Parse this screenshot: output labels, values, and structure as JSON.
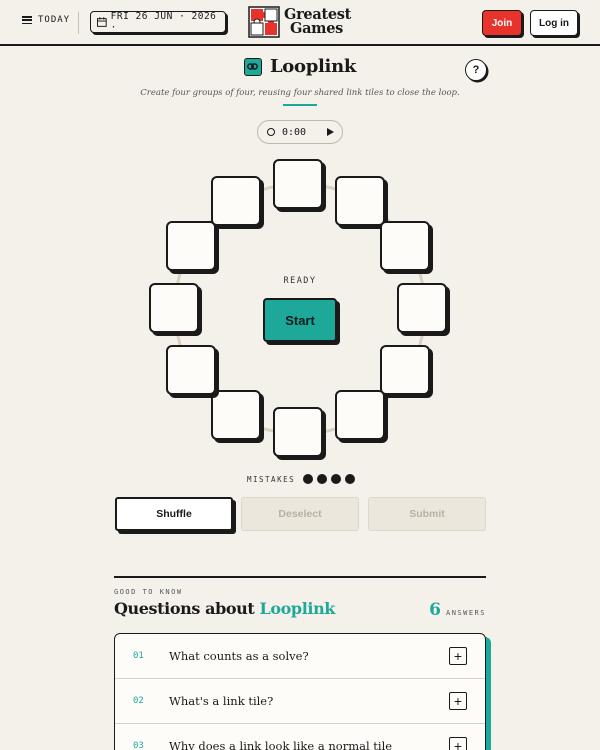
{
  "header": {
    "today_label": "TODAY",
    "date_label": "FRI 26 JUN · 2026 ·",
    "logo_line1": "Greatest",
    "logo_line2": "Games",
    "join_label": "Join",
    "login_label": "Log in"
  },
  "game": {
    "title": "Looplink",
    "subtitle": "Create four groups of four, reusing four shared link tiles to close the loop.",
    "help_label": "?",
    "timer": "0:00",
    "status": "READY",
    "start_label": "Start",
    "mistakes_label": "MISTAKES",
    "mistakes_remaining": 4,
    "tile_count": 12
  },
  "actions": {
    "shuffle": "Shuffle",
    "deselect": "Deselect",
    "submit": "Submit"
  },
  "faq": {
    "eyebrow": "GOOD TO KNOW",
    "title_prefix": "Questions about ",
    "title_accent": "Looplink",
    "count": "6",
    "count_label": "ANSWERS",
    "items": [
      {
        "num": "01",
        "question": "What counts as a solve?"
      },
      {
        "num": "02",
        "question": "What's a link tile?"
      },
      {
        "num": "03",
        "question": "Why does a link look like a normal tile"
      }
    ]
  },
  "colors": {
    "background": "#f4f1ea",
    "accent": "#1ea89a",
    "join": "#e8322c",
    "ink": "#1a1a1a"
  },
  "icons": [
    "hamburger-icon",
    "calendar-icon",
    "link-icon",
    "clock-icon",
    "play-icon",
    "plus-icon"
  ]
}
